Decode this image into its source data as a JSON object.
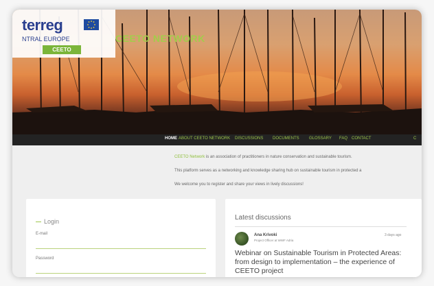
{
  "header": {
    "logo_interreg": "terreg",
    "logo_central": "NTRAL EUROPE",
    "logo_badge": "CEETO",
    "site_title": "CEETO NETWORK"
  },
  "nav": {
    "items": [
      {
        "label": "HOME",
        "active": true
      },
      {
        "label": "ABOUT CEETO NETWORK",
        "active": false
      },
      {
        "label": "DISCUSSIONS",
        "active": false
      },
      {
        "label": "DOCUMENTS",
        "active": false
      },
      {
        "label": "GLOSSARY",
        "active": false
      },
      {
        "label": "FAQ",
        "active": false
      },
      {
        "label": "CONTACT",
        "active": false
      },
      {
        "label": "C",
        "active": false
      }
    ]
  },
  "intro": {
    "line1_link": "CEETO Network",
    "line1_rest": " is an association of practitioners in nature conservation and sustainable tourism.",
    "line2": "This platform serves as a networking and knowledge sharing hub on sustainable tourism in protected a",
    "line3": "We welcome you to register and share your views in lively discussions!"
  },
  "login": {
    "title": "Login",
    "email_label": "E-mail",
    "password_label": "Password"
  },
  "discussions": {
    "title": "Latest discussions",
    "author": "Ana Krivoki",
    "role": "Project Officer at WWF Adria",
    "ago": "3 days ago",
    "headline": "Webinar on Sustainable Tourism in Protected Areas: from design to implementation – the experience of CEETO project"
  },
  "colors": {
    "accent_green": "#9dc64b",
    "nav_bg": "#232323",
    "logo_blue": "#2a3f8f"
  }
}
